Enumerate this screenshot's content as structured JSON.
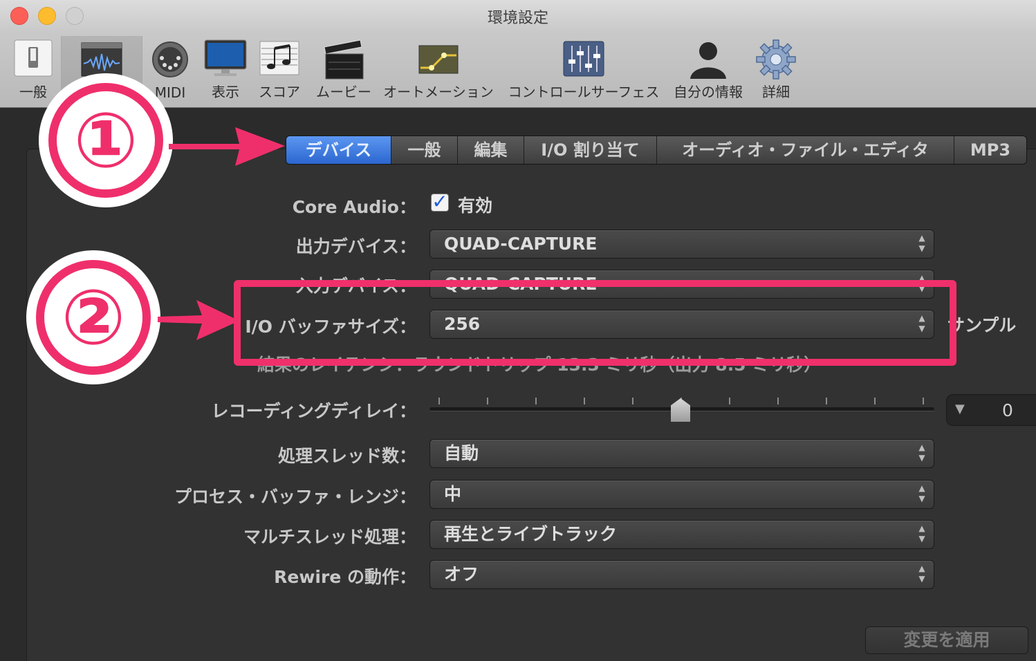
{
  "window": {
    "title": "環境設定"
  },
  "toolbar": {
    "items": [
      {
        "label": "一般",
        "icon": "switch-icon"
      },
      {
        "label": "",
        "icon": "waveform-icon"
      },
      {
        "label": "MIDI",
        "icon": "midi-connector-icon"
      },
      {
        "label": "表示",
        "icon": "monitor-icon"
      },
      {
        "label": "スコア",
        "icon": "score-icon"
      },
      {
        "label": "ムービー",
        "icon": "clapperboard-icon"
      },
      {
        "label": "オートメーション",
        "icon": "automation-icon"
      },
      {
        "label": "コントロールサーフェス",
        "icon": "faders-icon"
      },
      {
        "label": "自分の情報",
        "icon": "person-icon"
      },
      {
        "label": "詳細",
        "icon": "gear-icon"
      }
    ]
  },
  "tabs": [
    "デバイス",
    "一般",
    "編集",
    "I/O 割り当て",
    "オーディオ・ファイル・エディタ",
    "MP3"
  ],
  "settings": {
    "core_audio_label": "Core Audio：",
    "core_audio_checkbox": "有効",
    "output_device_label": "出力デバイス：",
    "output_device_value": "QUAD-CAPTURE",
    "input_device_label": "入力デバイス：",
    "input_device_value": "QUAD-CAPTURE",
    "buffer_label": "I/O バッファサイズ：",
    "buffer_value": "256",
    "buffer_unit": "サンプル",
    "latency_text": "結果のレイテンシ：ラウンドトリップ 13.3 ミリ秒（出力 8.5 ミリ秒）",
    "recording_delay_label": "レコーディングディレイ：",
    "recording_delay_value": "0",
    "threads_label": "処理スレッド数：",
    "threads_value": "自動",
    "process_buffer_label": "プロセス・バッファ・レンジ：",
    "process_buffer_value": "中",
    "multithread_label": "マルチスレッド処理：",
    "multithread_value": "再生とライブトラック",
    "rewire_label": "Rewire の動作：",
    "rewire_value": "オフ",
    "apply_button": "変更を適用"
  },
  "annotations": {
    "badge1": "①",
    "badge2": "②",
    "accent_color": "#ef2f6b"
  }
}
